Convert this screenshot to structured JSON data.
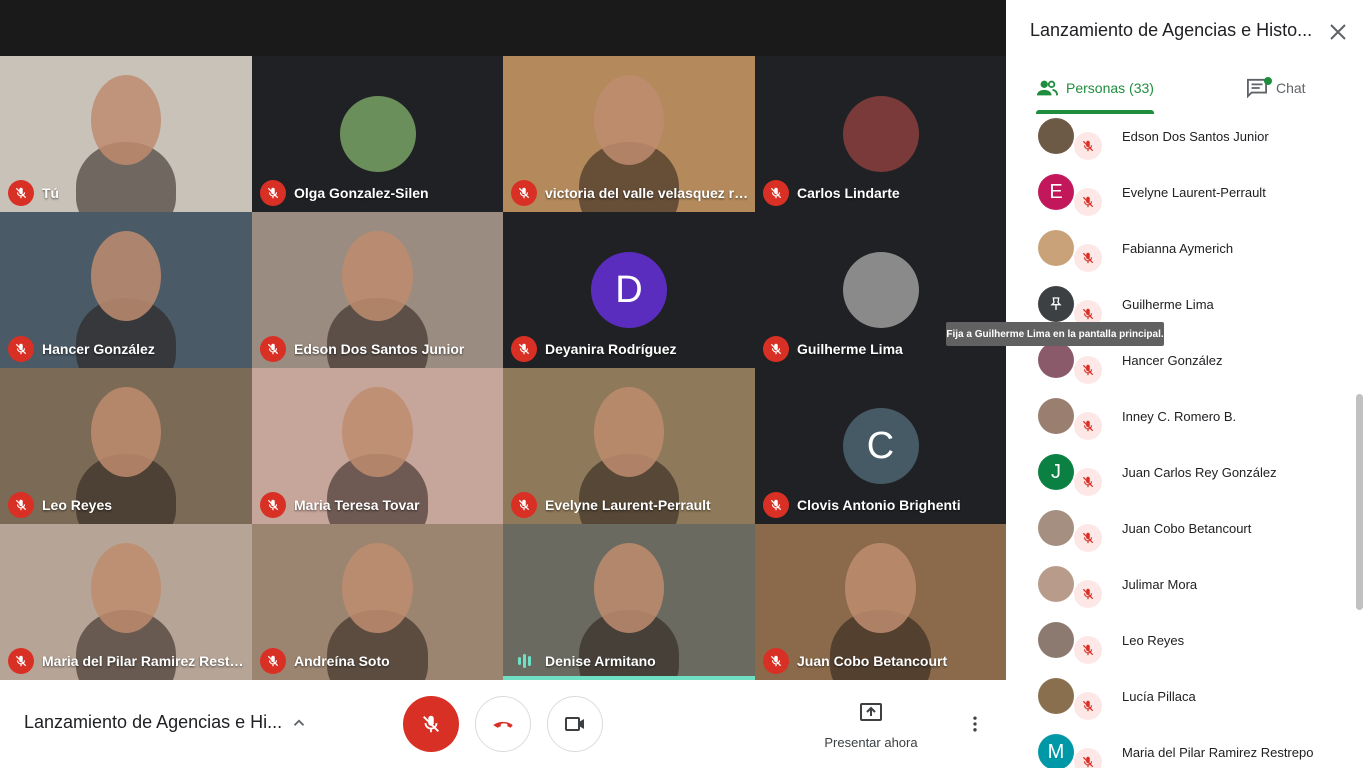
{
  "meeting": {
    "title": "Lanzamiento de Agencias e Hi...",
    "panel_title": "Lanzamiento de Agencias e Histo..."
  },
  "tiles": [
    {
      "name": "Tú",
      "muted": true,
      "bg": "#c9c2b8"
    },
    {
      "name": "Olga Gonzalez-Silen",
      "muted": true,
      "bg": "#202124",
      "avatar_color": "#6b8f5a"
    },
    {
      "name": "victoria del valle velasquez rojas",
      "muted": true,
      "bg": "#b48a5c"
    },
    {
      "name": "Carlos Lindarte",
      "muted": true,
      "bg": "#202124",
      "avatar_color": "#7a3a3a"
    },
    {
      "name": "Hancer González",
      "muted": true,
      "bg": "#4a5a66"
    },
    {
      "name": "Edson Dos Santos Junior",
      "muted": true,
      "bg": "#9a8c80"
    },
    {
      "name": "Deyanira Rodríguez",
      "muted": true,
      "bg": "#202124",
      "avatar_color": "#5b2dbf",
      "initial": "D"
    },
    {
      "name": "Guilherme Lima",
      "muted": true,
      "bg": "#202124",
      "avatar_color": "#8a8a8a"
    },
    {
      "name": "Leo Reyes",
      "muted": true,
      "bg": "#7a6a56"
    },
    {
      "name": "Maria Teresa Tovar",
      "muted": true,
      "bg": "#c6a59a"
    },
    {
      "name": "Evelyne Laurent-Perrault",
      "muted": true,
      "bg": "#8e7a5a"
    },
    {
      "name": "Clovis Antonio Brighenti",
      "muted": true,
      "bg": "#202124",
      "avatar_color": "#455a64",
      "initial": "C"
    },
    {
      "name": "Maria del Pilar Ramirez Restre...",
      "muted": true,
      "bg": "#b6a596"
    },
    {
      "name": "Andreína Soto",
      "muted": true,
      "bg": "#9c8570"
    },
    {
      "name": "Denise Armitano",
      "muted": false,
      "speaking": true,
      "bg": "#6a6a60"
    },
    {
      "name": "Juan Cobo Betancourt",
      "muted": true,
      "bg": "#8a6a4a"
    }
  ],
  "controls": {
    "present_label": "Presentar ahora"
  },
  "panel": {
    "people_tab": "Personas (33)",
    "chat_tab": "Chat",
    "tooltip": "Fija a Guilherme Lima en la pantalla principal.",
    "participants": [
      {
        "name": "Edson Dos Santos Junior",
        "color": "#6d5a46"
      },
      {
        "name": "Evelyne Laurent-Perrault",
        "color": "#c2185b",
        "initial": "E"
      },
      {
        "name": "Fabianna Aymerich",
        "color": "#c9a27a"
      },
      {
        "name": "Guilherme Lima",
        "color": "#3c4043",
        "pin": true
      },
      {
        "name": "Hancer González",
        "color": "#8a5a6a"
      },
      {
        "name": "Inney C. Romero B.",
        "color": "#9a7f70"
      },
      {
        "name": "Juan Carlos Rey González",
        "color": "#0b8043",
        "initial": "J"
      },
      {
        "name": "Juan Cobo Betancourt",
        "color": "#a58f80"
      },
      {
        "name": "Julimar Mora",
        "color": "#b89b8a"
      },
      {
        "name": "Leo Reyes",
        "color": "#8c7a70"
      },
      {
        "name": "Lucía Pillaca",
        "color": "#8a6f4e"
      },
      {
        "name": "Maria del Pilar Ramirez Restrepo",
        "color": "#0097a7",
        "initial": "M"
      }
    ]
  }
}
